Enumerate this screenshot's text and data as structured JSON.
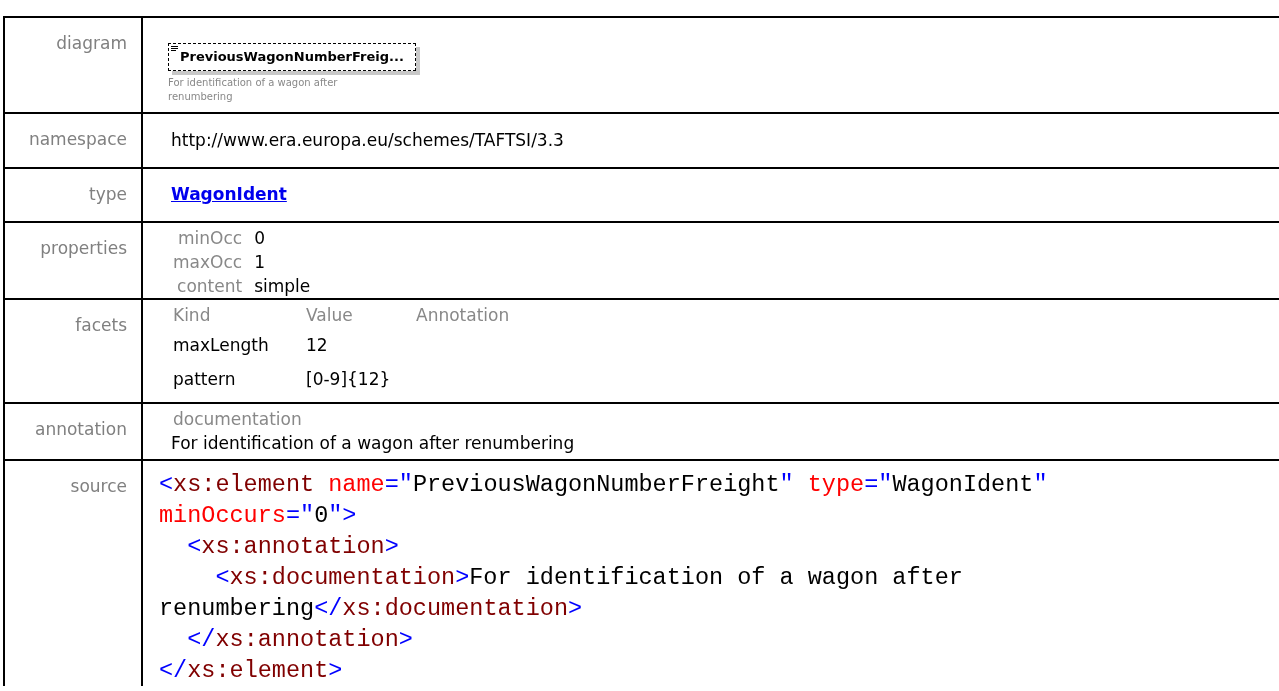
{
  "rows": [
    {
      "kind": "diagram",
      "label": "diagram",
      "element_name": "PreviousWagonNumberFreig...",
      "caption": "For identification of a wagon after renumbering"
    },
    {
      "kind": "text",
      "label": "namespace",
      "value": "http://www.era.europa.eu/schemes/TAFTSI/3.3"
    },
    {
      "kind": "link",
      "label": "type",
      "value": "WagonIdent"
    },
    {
      "kind": "properties",
      "label": "properties",
      "items": [
        {
          "name": "minOcc",
          "value": "0"
        },
        {
          "name": "maxOcc",
          "value": "1"
        },
        {
          "name": "content",
          "value": "simple"
        }
      ]
    },
    {
      "kind": "facets",
      "label": "facets",
      "columns": [
        "Kind",
        "Value",
        "Annotation"
      ],
      "items": [
        {
          "kind": "maxLength",
          "value": "12"
        },
        {
          "kind": "pattern",
          "value": "[0-9]{12}"
        }
      ]
    },
    {
      "kind": "annotation",
      "label": "annotation",
      "heading": "documentation",
      "text": "For identification of a wagon after renumbering"
    },
    {
      "kind": "source",
      "label": "source",
      "lines": [
        [
          {
            "kind": "punct",
            "text": "<"
          },
          {
            "kind": "tag",
            "text": "xs:element"
          },
          {
            "kind": "attr",
            "text": " name"
          },
          {
            "kind": "punct",
            "text": "=\""
          },
          {
            "kind": "value",
            "text": "PreviousWagonNumberFreight"
          },
          {
            "kind": "punct",
            "text": "\""
          },
          {
            "kind": "attr",
            "text": " type"
          },
          {
            "kind": "punct",
            "text": "=\""
          },
          {
            "kind": "value",
            "text": "WagonIdent"
          },
          {
            "kind": "punct",
            "text": "\""
          }
        ],
        [
          {
            "kind": "attr",
            "text": "minOccurs"
          },
          {
            "kind": "punct",
            "text": "=\""
          },
          {
            "kind": "value",
            "text": "0"
          },
          {
            "kind": "punct",
            "text": "\">"
          }
        ],
        [
          {
            "kind": "punct",
            "text": "  <"
          },
          {
            "kind": "tag",
            "text": "xs:annotation"
          },
          {
            "kind": "punct",
            "text": ">"
          }
        ],
        [
          {
            "kind": "punct",
            "text": "    <"
          },
          {
            "kind": "tag",
            "text": "xs:documentation"
          },
          {
            "kind": "punct",
            "text": ">"
          },
          {
            "kind": "value",
            "text": "For identification of a wagon after"
          }
        ],
        [
          {
            "kind": "value",
            "text": "renumbering"
          },
          {
            "kind": "punct",
            "text": "</"
          },
          {
            "kind": "tag",
            "text": "xs:documentation"
          },
          {
            "kind": "punct",
            "text": ">"
          }
        ],
        [
          {
            "kind": "punct",
            "text": "  </"
          },
          {
            "kind": "tag",
            "text": "xs:annotation"
          },
          {
            "kind": "punct",
            "text": ">"
          }
        ],
        [
          {
            "kind": "punct",
            "text": "</"
          },
          {
            "kind": "tag",
            "text": "xs:element"
          },
          {
            "kind": "punct",
            "text": ">"
          }
        ]
      ]
    }
  ]
}
